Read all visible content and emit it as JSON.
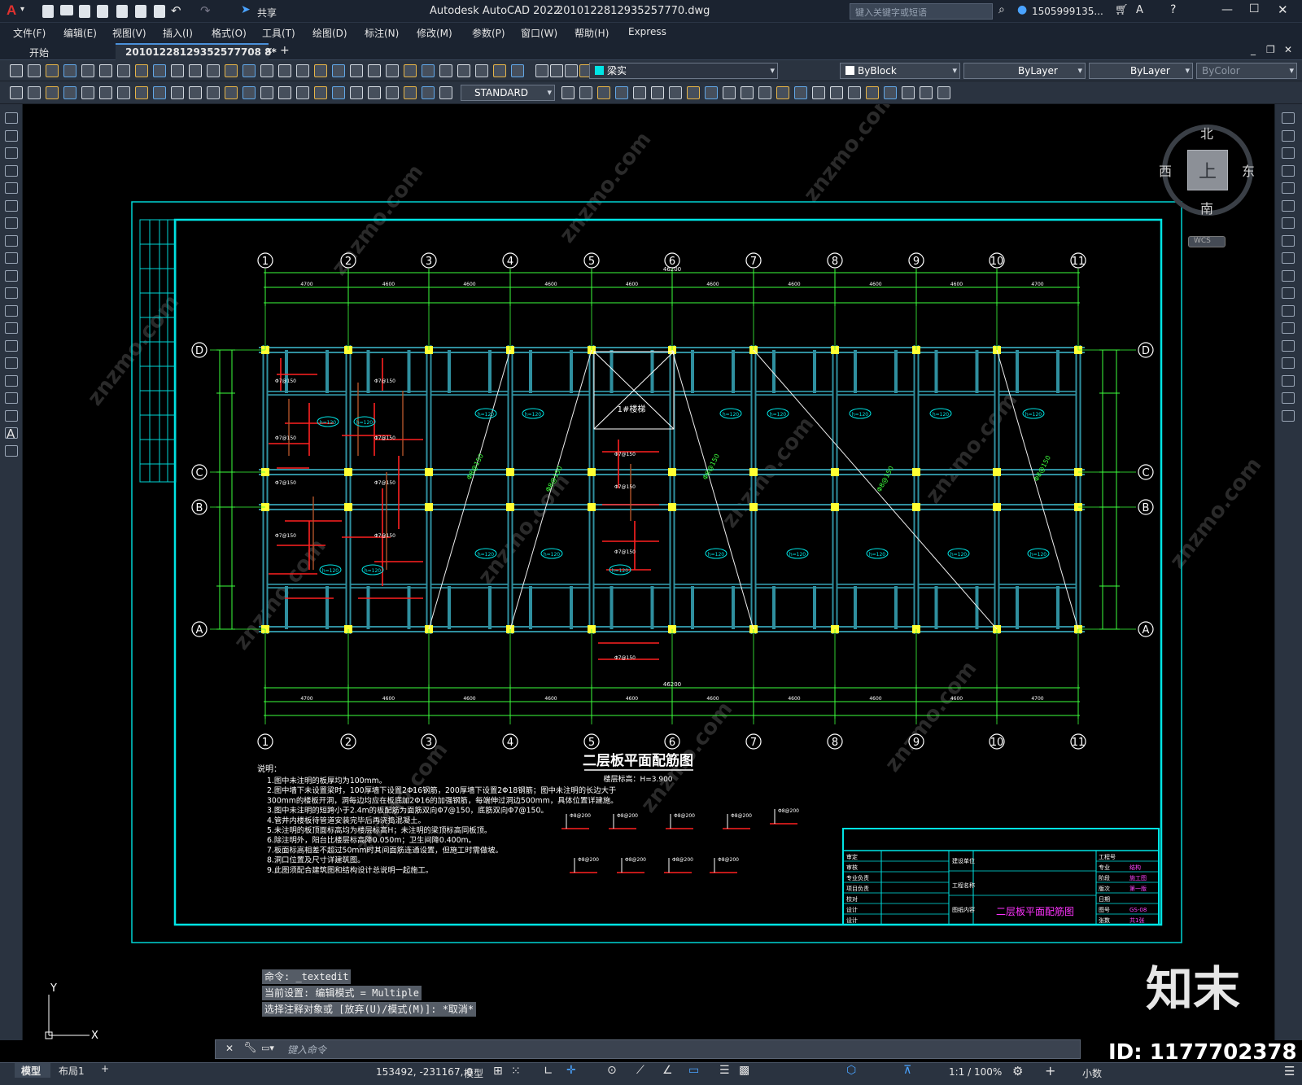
{
  "app": {
    "title": "Autodesk AutoCAD 2022",
    "filename": "2010122812935257770.dwg",
    "share_label": "共享",
    "search_placeholder": "键入关键字或短语",
    "user": "1505999135..."
  },
  "menu": [
    "文件(F)",
    "编辑(E)",
    "视图(V)",
    "插入(I)",
    "格式(O)",
    "工具(T)",
    "绘图(D)",
    "标注(N)",
    "修改(M)",
    "参数(P)",
    "窗口(W)",
    "帮助(H)",
    "Express"
  ],
  "tabs": {
    "start": "开始",
    "file": "20101228129352577708 8*",
    "add": "+"
  },
  "properties": {
    "layer": "梁实",
    "color": "ByBlock",
    "linetype": "ByLayer",
    "lineweight": "ByLayer",
    "plotstyle": "ByColor",
    "textstyle": "STANDARD"
  },
  "viewcube": {
    "north": "北",
    "south": "南",
    "east": "东",
    "west": "西",
    "top": "上",
    "wcs": "WCS"
  },
  "command_history": [
    "命令: _textedit",
    "当前设置: 编辑模式 = Multiple",
    "选择注释对象或 [放弃(U)/模式(M)]: *取消*"
  ],
  "command_placeholder": "键入命令",
  "status": {
    "coords": "153492, -231167, 0",
    "model_label": "模型",
    "tabs": [
      "模型",
      "布局1"
    ],
    "scale": "1:1 / 100%",
    "units": "小数"
  },
  "watermark": {
    "brand": "知末",
    "id": "ID: 1177702378"
  },
  "drawing": {
    "axes_numbers": [
      "1",
      "2",
      "3",
      "4",
      "5",
      "6",
      "7",
      "8",
      "9",
      "10",
      "11"
    ],
    "axes_letters": [
      "A",
      "B",
      "C",
      "D"
    ],
    "total_dim": "46200",
    "span_dims": [
      "4700",
      "4600",
      "4600",
      "4600",
      "4600",
      "4600",
      "4600",
      "4600",
      "4600",
      "4700"
    ],
    "title": "二层板平面配筋图",
    "subtitle": "楼层标高：H=3.900",
    "stair_label": "1#楼梯",
    "notes_title": "说明：",
    "notes": [
      "1.图中未注明的板厚均为100mm。",
      "2.图中墙下未设置梁时，100厚墙下设置2Φ16钢筋，200厚墙下设置2Φ18钢筋；图中未注明的长边大于",
      "300mm的楼板开洞，洞每边均应在板底加2Φ16的加强钢筋，每端伸过洞边500mm，具体位置详建施。",
      "3.图中未注明的短跨小于2.4m的板配筋为面筋双向Φ7@150，底筋双向Φ7@150。",
      "4.管井内楼板待管道安装完毕后再浇捣混凝土。",
      "5.未注明的板顶面标高均为楼层标高H；未注明的梁顶标高同板顶。",
      "6.除注明外，阳台比楼层标高降0.050m；卫生间降0.400m。",
      "7.板面标高相差不超过50mm时其间面筋连通设置，但施工时需做坡。",
      "8.洞口位置及尺寸详建筑图。",
      "9.此图须配合建筑图和结构设计总说明一起施工。"
    ],
    "titleblock": {
      "drawing_name": "二层板平面配筋图",
      "drawing_no": "GS-08",
      "left_rows": [
        "审定",
        "审核",
        "专业负责",
        "项目负责",
        "校对",
        "设计",
        "设计"
      ],
      "mid_rows": [
        "建设单位",
        "工程名称",
        "图纸内容"
      ],
      "right_labels": [
        "工程号",
        "专业",
        "阶段",
        "版次",
        "日期",
        "图号",
        "张数"
      ],
      "right_values": [
        "",
        "结构",
        "施工图",
        "第一版",
        "",
        "GS-08",
        "共1张"
      ]
    }
  }
}
